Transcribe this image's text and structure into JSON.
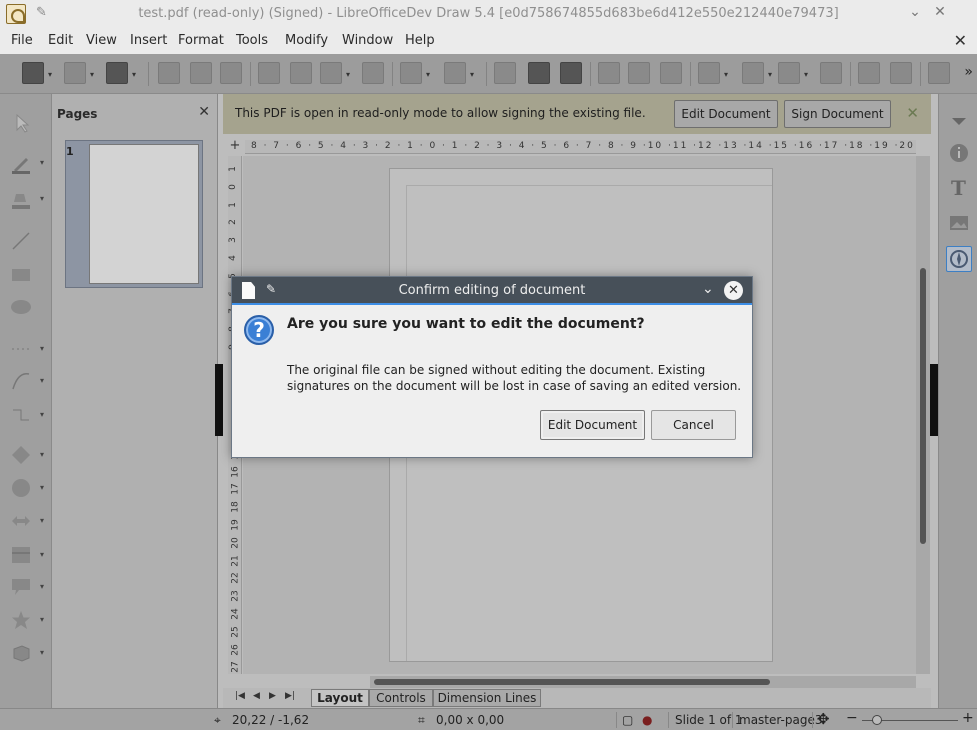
{
  "window": {
    "title": "test.pdf (read-only) (Signed) - LibreOfficeDev Draw 5.4 [e0d758674855d683be6d412e550e212440e79473]",
    "minimize_glyph": "⌄",
    "close_glyph": "✕"
  },
  "menu": {
    "items": [
      "File",
      "Edit",
      "View",
      "Insert",
      "Format",
      "Tools",
      "Modify",
      "Window",
      "Help"
    ],
    "close_doc": "✕"
  },
  "pages_pane": {
    "title": "Pages",
    "close": "✕",
    "thumb_number": "1"
  },
  "infobar": {
    "message": "This PDF is open in read-only mode to allow signing the existing file.",
    "edit_button": "Edit Document",
    "sign_button": "Sign Document",
    "close": "✕"
  },
  "ruler": {
    "horizontal": "8 · 7 · 6 · 5 · 4 · 3 · 2 · 1 · 0 · 1 · 2 · 3 · 4 · 5 · 6 · 7 · 8 · 9 ·10 ·11 ·12 ·13 ·14 ·15 ·16 ·17 ·18 ·19 ·20 ·21 ·22 ·23 ·24 ·25 ·26 ·27 ·28",
    "vertical": [
      "1",
      "0",
      "1",
      "2",
      "3",
      "4",
      "5",
      "6",
      "7",
      "8",
      "9",
      "10",
      "11",
      "12",
      "13",
      "14",
      "15",
      "16",
      "17",
      "18",
      "19",
      "20",
      "21",
      "22",
      "23",
      "24",
      "25",
      "26",
      "27"
    ]
  },
  "tabs": {
    "items": [
      "Layout",
      "Controls",
      "Dimension Lines"
    ],
    "active": "Layout"
  },
  "statusbar": {
    "position": "20,22 / -1,62",
    "size": "0,00 x 0,00",
    "slide": "Slide 1 of 1",
    "master": "master-page3"
  },
  "dialog": {
    "title": "Confirm editing of document",
    "heading": "Are you sure you want to edit the document?",
    "body": "The original file can be signed without editing the document. Existing signatures on the document will be lost in case of saving an edited version.",
    "edit_button": "Edit Document",
    "cancel_button": "Cancel",
    "question_glyph": "?",
    "close_glyph": "✕",
    "collapse_glyph": "⌄",
    "pin_glyph": "📌"
  },
  "colors": {
    "dialog_titlebar": "#475059",
    "dialog_accent": "#3d8ee6",
    "question_icon": "#3a7fd5",
    "infobar": "#a5a38e"
  }
}
